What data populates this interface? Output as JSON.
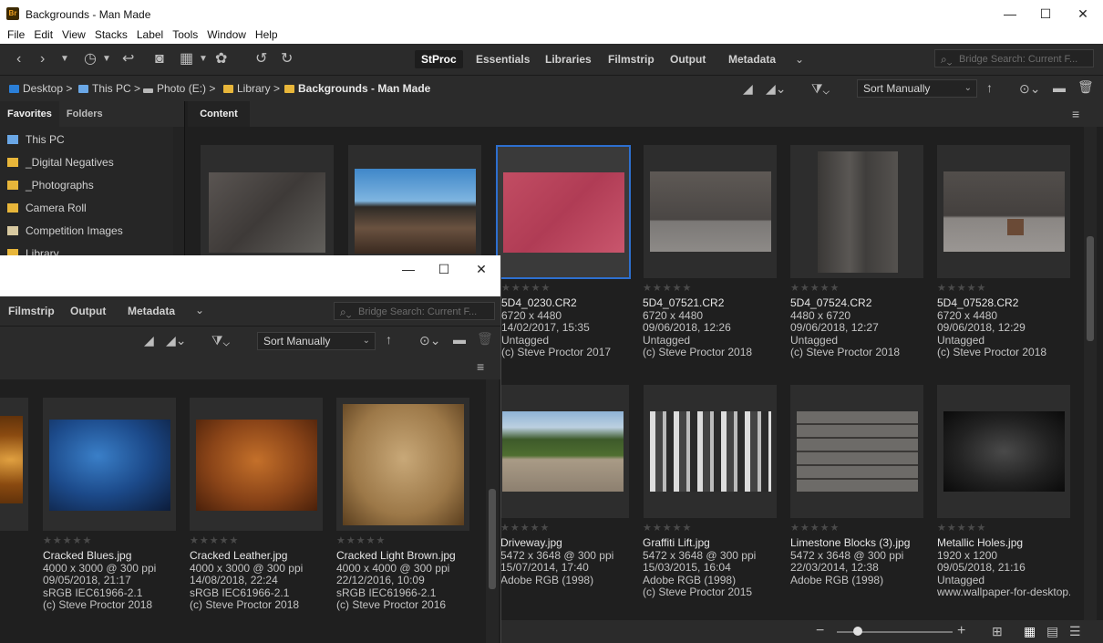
{
  "window": {
    "app_icon": "Br",
    "title": "Backgrounds - Man Made",
    "minimize": "—",
    "maximize": "☐",
    "close": "✕"
  },
  "menu": [
    "File",
    "Edit",
    "View",
    "Stacks",
    "Label",
    "Tools",
    "Window",
    "Help"
  ],
  "workspaces": [
    {
      "label": "StProc",
      "active": true
    },
    {
      "label": "Essentials",
      "active": false
    },
    {
      "label": "Libraries",
      "active": false
    },
    {
      "label": "Filmstrip",
      "active": false
    },
    {
      "label": "Output",
      "active": false
    },
    {
      "label": "Metadata",
      "active": false
    }
  ],
  "search": {
    "placeholder": "Bridge Search: Current F..."
  },
  "breadcrumb": [
    {
      "label": "Desktop",
      "icon": "desktop-icon"
    },
    {
      "label": "This PC",
      "icon": "computer-icon"
    },
    {
      "label": "Photo (E:)",
      "icon": "drive-icon"
    },
    {
      "label": "Library",
      "icon": "folder-icon"
    },
    {
      "label": "Backgrounds - Man Made",
      "icon": "folder-icon"
    }
  ],
  "sort": {
    "label": "Sort Manually"
  },
  "left_panel": {
    "tabs": [
      "Favorites",
      "Folders"
    ],
    "items": [
      {
        "label": "This PC",
        "icon": "computer-icon"
      },
      {
        "label": "_Digital Negatives",
        "icon": "folder-icon"
      },
      {
        "label": "_Photographs",
        "icon": "folder-icon"
      },
      {
        "label": "Camera Roll",
        "icon": "folder-icon"
      },
      {
        "label": "Competition Images",
        "icon": "image-folder-icon"
      },
      {
        "label": "Library",
        "icon": "folder-icon"
      }
    ]
  },
  "content_tab": "Content",
  "row1": [
    {
      "name": "",
      "l1": "",
      "l2": "",
      "l3": "",
      "l4": ""
    },
    {
      "name": "",
      "l1": "",
      "l2": "",
      "l3": "",
      "l4": ""
    },
    {
      "name": "5D4_0230.CR2",
      "l1": "6720 x 4480",
      "l2": "14/02/2017, 15:35",
      "l3": "Untagged",
      "l4": "(c) Steve Proctor 2017"
    },
    {
      "name": "5D4_07521.CR2",
      "l1": "6720 x 4480",
      "l2": "09/06/2018, 12:26",
      "l3": "Untagged",
      "l4": "(c) Steve Proctor 2018"
    },
    {
      "name": "5D4_07524.CR2",
      "l1": "4480 x 6720",
      "l2": "09/06/2018, 12:27",
      "l3": "Untagged",
      "l4": "(c) Steve Proctor 2018"
    },
    {
      "name": "5D4_07528.CR2",
      "l1": "6720 x 4480",
      "l2": "09/06/2018, 12:29",
      "l3": "Untagged",
      "l4": "(c) Steve Proctor 2018"
    }
  ],
  "row2": [
    {
      "name": "Driveway.jpg",
      "l1": "5472 x 3648 @ 300 ppi",
      "l2": "15/07/2014, 17:40",
      "l3": "Adobe RGB (1998)",
      "l4": ""
    },
    {
      "name": "Graffiti Lift.jpg",
      "l1": "5472 x 3648 @ 300 ppi",
      "l2": "15/03/2015, 16:04",
      "l3": "Adobe RGB (1998)",
      "l4": "(c) Steve Proctor 2015"
    },
    {
      "name": "Limestone Blocks (3).jpg",
      "l1": "5472 x 3648 @ 300 ppi",
      "l2": "22/03/2014, 12:38",
      "l3": "Adobe RGB (1998)",
      "l4": ""
    },
    {
      "name": "Metallic Holes.jpg",
      "l1": "1920 x 1200",
      "l2": "09/05/2018, 21:16",
      "l3": "Untagged",
      "l4": "www.wallpaper-for-desktop...."
    }
  ],
  "win2": {
    "workspaces": [
      "Filmstrip",
      "Output",
      "Metadata"
    ],
    "search_placeholder": "Bridge Search: Current F...",
    "sort": "Sort Manually",
    "items": [
      {
        "name": "Cracked Blues.jpg",
        "l1": "4000 x 3000 @ 300 ppi",
        "l2": "09/05/2018, 21:17",
        "l3": "sRGB IEC61966-2.1",
        "l4": "(c) Steve Proctor 2018"
      },
      {
        "name": "Cracked Leather.jpg",
        "l1": "4000 x 3000 @ 300 ppi",
        "l2": "14/08/2018, 22:24",
        "l3": "sRGB IEC61966-2.1",
        "l4": "(c) Steve Proctor 2018"
      },
      {
        "name": "Cracked Light Brown.jpg",
        "l1": "4000 x 4000 @ 300 ppi",
        "l2": "22/12/2016, 10:09",
        "l3": "sRGB IEC61966-2.1",
        "l4": "(c) Steve Proctor 2016"
      }
    ]
  },
  "stars": "★★★★★",
  "colors": {
    "selection": "#2d6fcf",
    "background": "#1f1f1f",
    "panel": "#2b2b2b"
  }
}
